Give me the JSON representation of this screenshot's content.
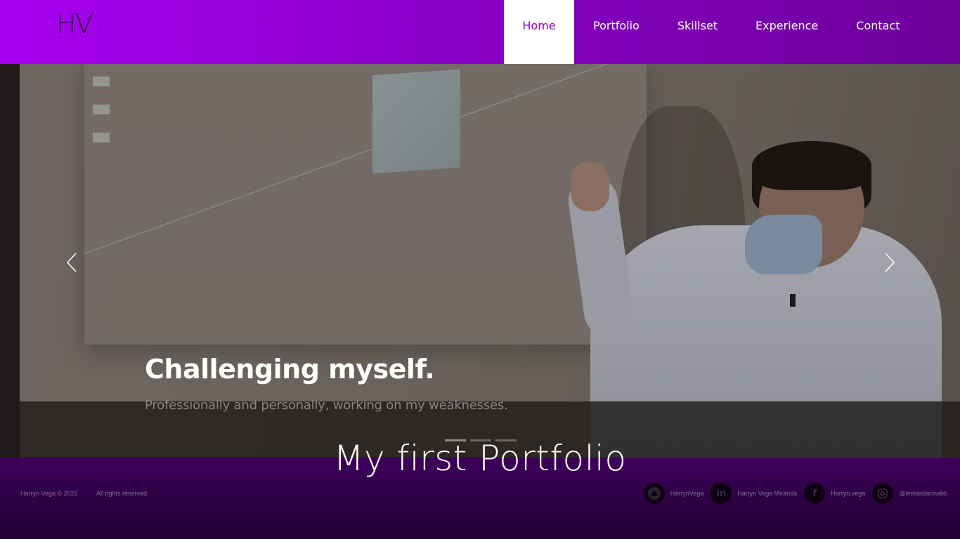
{
  "header": {
    "logo": "HV",
    "nav": [
      {
        "label": "Home",
        "active": true
      },
      {
        "label": "Portfolio"
      },
      {
        "label": "Skillset"
      },
      {
        "label": "Experience"
      },
      {
        "label": "Contact"
      }
    ]
  },
  "carousel": {
    "title": "Challenging myself.",
    "subtitle": "Professionally and personally, working on my weaknesses.",
    "slide_count": 3,
    "active_slide": 1
  },
  "hero": {
    "title": "My first Portfolio"
  },
  "footer": {
    "copyright": "Harryn Vega © 2022",
    "rights": "All rights reserved",
    "socials": [
      {
        "icon": "github-icon",
        "label": "HarrynVega"
      },
      {
        "icon": "linkedin-icon",
        "label": "Harryn Vega Miranda"
      },
      {
        "icon": "facebook-icon",
        "label": "Harryn.vega"
      },
      {
        "icon": "instagram-icon",
        "label": "@lemandarinabb"
      }
    ]
  },
  "colors": {
    "header_gradient_start": "#a800f0",
    "header_gradient_end": "#6c0099",
    "active_nav_text": "#8b00c8",
    "footer_bg": "#2a0040"
  }
}
